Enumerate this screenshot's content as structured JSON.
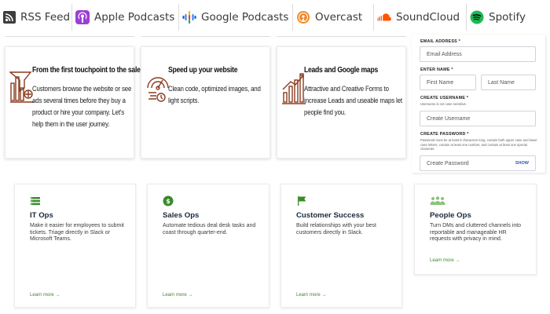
{
  "podcast_bar": {
    "rss": "RSS Feed",
    "apple": "Apple Podcasts",
    "google": "Google Podcasts",
    "overcast": "Overcast",
    "soundcloud": "SoundCloud",
    "spotify": "Spotify"
  },
  "feature_cards": [
    {
      "title": "From the first touchpoint to the sale",
      "body": "Customers browse the website or see ads several times before they buy a product or hire your company. Let's help them in the user journey.",
      "icon": "funnel-chart-icon"
    },
    {
      "title": "Speed up your website",
      "body": "Clean code, optimized images, and light scripts.",
      "icon": "speedometer-icon"
    },
    {
      "title": "Leads and Google maps",
      "body": "Attractive and Creative Forms to increase Leads and useable maps let people find you.",
      "icon": "growth-chart-icon"
    }
  ],
  "signup_form": {
    "email_label": "EMAIL ADDRESS *",
    "email_placeholder": "Email Address",
    "name_label": "ENTER NAME *",
    "first_placeholder": "First Name",
    "last_placeholder": "Last Name",
    "username_label": "CREATE USERNAME *",
    "username_help": "Username is not case sensitive.",
    "username_placeholder": "Create Username",
    "password_label": "CREATE PASSWORD *",
    "password_help": "Password must be at least 8 characters long, contain both upper case and lower case letters, contain at least one number, and contain at least one special character.",
    "password_placeholder": "Create Password",
    "show_label": "SHOW"
  },
  "team_cards": [
    {
      "title": "IT Ops",
      "body": "Make it easier for employees to submit tickets. Triage directly in Slack or Microsoft Teams.",
      "link": "Learn more →",
      "icon": "server-list-icon"
    },
    {
      "title": "Sales Ops",
      "body": "Automate tedious deal desk tasks and coast through quarter-end.",
      "link": "Learn more →",
      "icon": "dollar-badge-icon"
    },
    {
      "title": "Customer Success",
      "body": "Build relationships with your best customers directly in Slack.",
      "link": "Learn more →",
      "icon": "flag-icon"
    },
    {
      "title": "People Ops",
      "body": "Turn DMs and cluttered channels into reportable and manageable HR requests with privacy in mind.",
      "link": "Learn more →",
      "icon": "people-group-icon"
    }
  ],
  "colors": {
    "accent_green": "#3a8a2a",
    "illustration_brown": "#8a3b1e",
    "apple_purple": "#9b3fd6",
    "overcast_orange": "#f08a2c",
    "soundcloud_orange": "#ff5500",
    "spotify_green": "#1db954"
  }
}
